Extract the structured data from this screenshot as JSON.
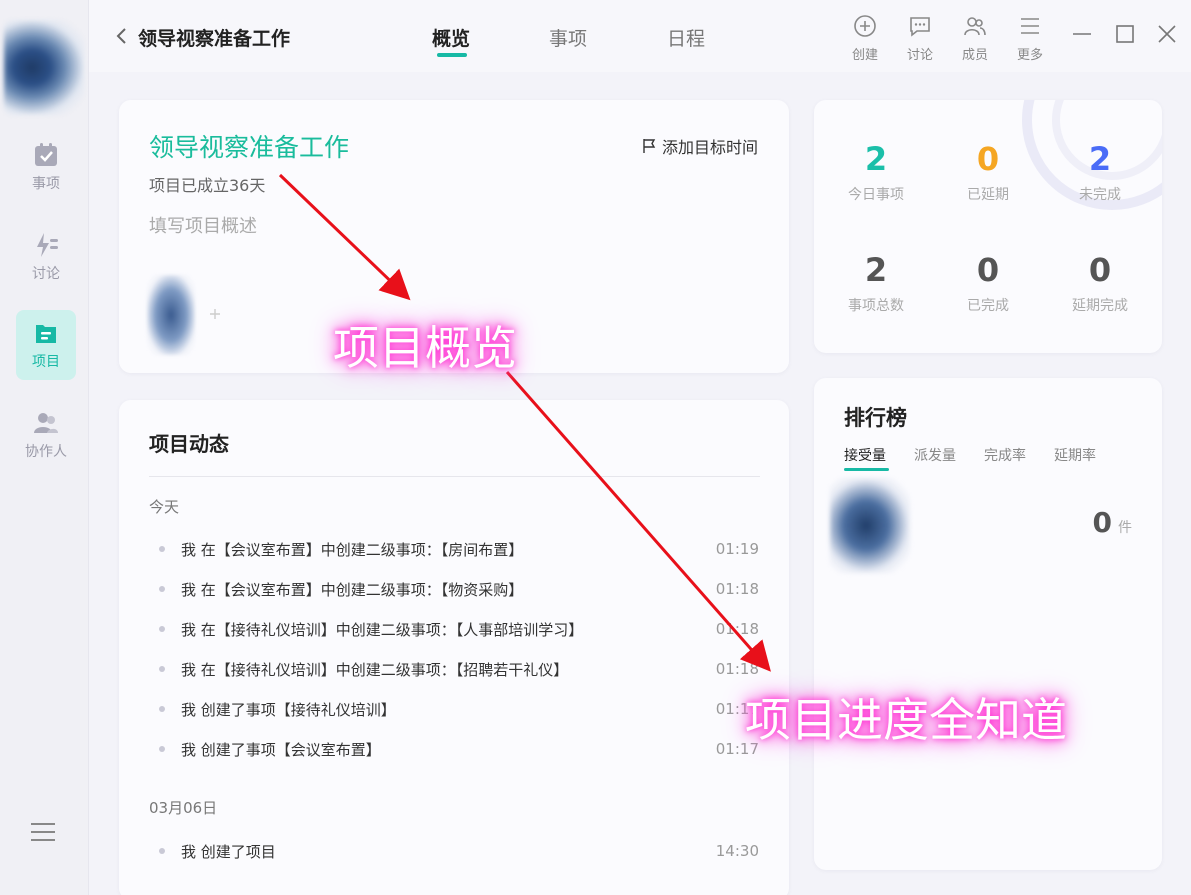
{
  "topbar": {
    "title": "领导视察准备工作",
    "tabs": [
      {
        "label": "概览",
        "active": true
      },
      {
        "label": "事项",
        "active": false
      },
      {
        "label": "日程",
        "active": false
      }
    ],
    "tools": [
      {
        "label": "创建",
        "icon": "plus-circle-icon"
      },
      {
        "label": "讨论",
        "icon": "chat-icon"
      },
      {
        "label": "成员",
        "icon": "members-icon"
      },
      {
        "label": "更多",
        "icon": "menu-icon"
      }
    ]
  },
  "sidebar": {
    "items": [
      {
        "label": "事项",
        "icon": "calendar-check-icon",
        "active": false
      },
      {
        "label": "讨论",
        "icon": "discussion-icon",
        "active": false
      },
      {
        "label": "项目",
        "icon": "folder-icon",
        "active": true
      },
      {
        "label": "协作人",
        "icon": "collaborators-icon",
        "active": false
      }
    ]
  },
  "overview": {
    "name": "领导视察准备工作",
    "days": "项目已成立36天",
    "desc_placeholder": "填写项目概述",
    "target_label": "添加目标时间"
  },
  "feed": {
    "title": "项目动态",
    "groups": [
      {
        "date": "今天",
        "items": [
          {
            "text": "我 在【会议室布置】中创建二级事项：【房间布置】",
            "time": "01:19"
          },
          {
            "text": "我 在【会议室布置】中创建二级事项：【物资采购】",
            "time": "01:18"
          },
          {
            "text": "我 在【接待礼仪培训】中创建二级事项：【人事部培训学习】",
            "time": "01:18"
          },
          {
            "text": "我 在【接待礼仪培训】中创建二级事项：【招聘若干礼仪】",
            "time": "01:18"
          },
          {
            "text": "我 创建了事项【接待礼仪培训】",
            "time": "01:17"
          },
          {
            "text": "我 创建了事项【会议室布置】",
            "time": "01:17"
          }
        ]
      },
      {
        "date": "03月06日",
        "items": [
          {
            "text": "我 创建了项目",
            "time": "14:30"
          }
        ]
      }
    ]
  },
  "stats": {
    "items": [
      {
        "value": "2",
        "label": "今日事项",
        "color": "#1bbfa9"
      },
      {
        "value": "0",
        "label": "已延期",
        "color": "#f5a623"
      },
      {
        "value": "2",
        "label": "未完成",
        "color": "#4a6cf7"
      },
      {
        "value": "2",
        "label": "事项总数",
        "color": "#555555"
      },
      {
        "value": "0",
        "label": "已完成",
        "color": "#555555"
      },
      {
        "value": "0",
        "label": "延期完成",
        "color": "#555555"
      }
    ]
  },
  "rank": {
    "title": "排行榜",
    "tabs": [
      "接受量",
      "派发量",
      "完成率",
      "延期率"
    ],
    "active_tab": "接受量",
    "count": "0",
    "unit": "件"
  },
  "annotations": {
    "overview_label": "项目概览",
    "progress_label": "项目进度全知道",
    "arrow_color": "#e8101a",
    "glow_color": "#ff2fd2"
  },
  "colors": {
    "accent": "#17b9a5",
    "background": "#f3f3f9"
  }
}
